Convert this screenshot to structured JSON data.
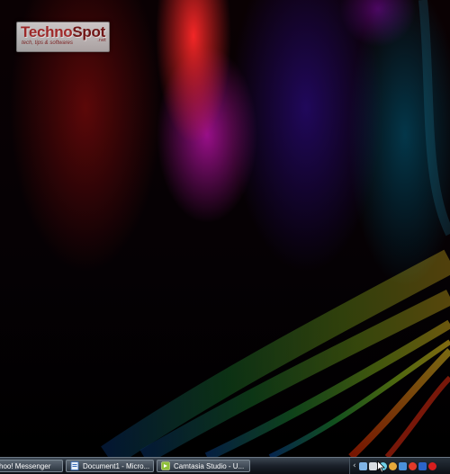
{
  "watermark": {
    "title_part1": "Techno",
    "title_part2": "Spot",
    "net": ".net",
    "tagline": "tech, tips & softwares"
  },
  "taskbar": {
    "buttons": [
      {
        "label": "hoo! Messenger",
        "icon": "messenger-icon"
      },
      {
        "label": "Document1 - Micro...",
        "icon": "word-document-icon"
      },
      {
        "label": "Camtasia Studio - U...",
        "icon": "camtasia-icon"
      }
    ],
    "tray": {
      "expand_glyph": "‹",
      "icons": [
        "network-icon",
        "volume-icon",
        "messenger-tray-icon",
        "globe-icon",
        "shield-icon",
        "opera-icon",
        "display-icon",
        "power-icon"
      ]
    }
  },
  "colors": {
    "taskbar": "#1a2029",
    "accent_red": "#ff2a2a",
    "accent_green": "#4ee01a"
  }
}
